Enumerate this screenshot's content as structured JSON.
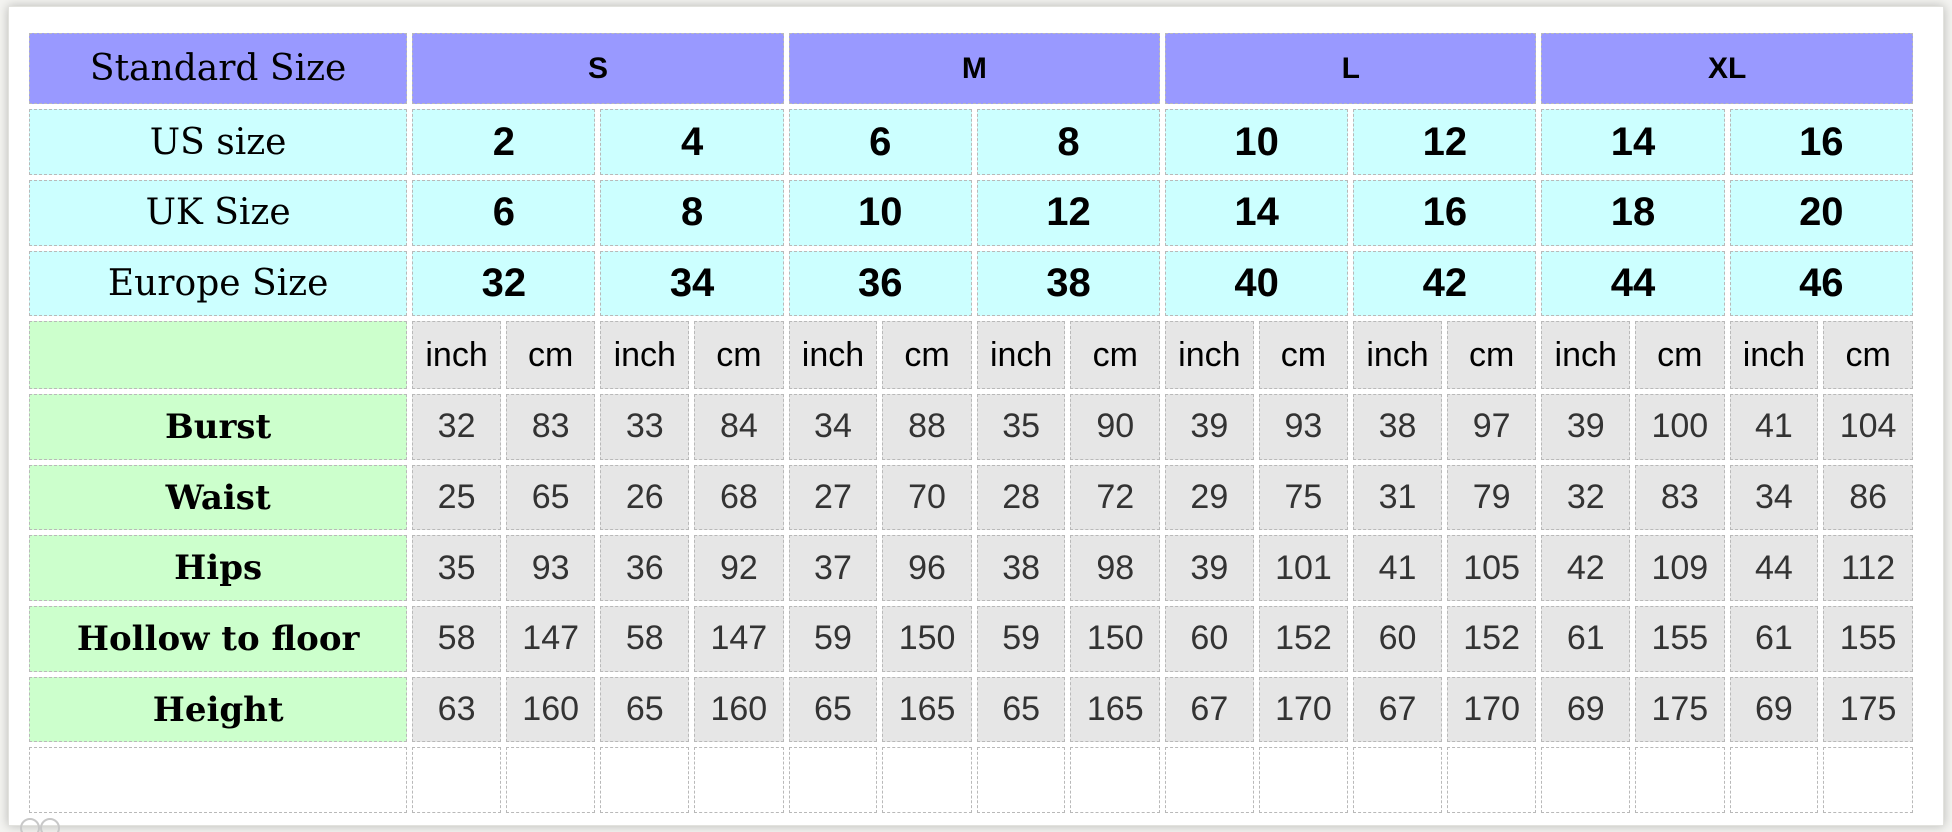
{
  "header": {
    "label": "Standard Size",
    "sizes": [
      "S",
      "M",
      "L",
      "XL"
    ]
  },
  "conversions": [
    {
      "label": "US size",
      "values": [
        "2",
        "4",
        "6",
        "8",
        "10",
        "12",
        "14",
        "16"
      ]
    },
    {
      "label": "UK Size",
      "values": [
        "6",
        "8",
        "10",
        "12",
        "14",
        "16",
        "18",
        "20"
      ]
    },
    {
      "label": "Europe Size",
      "values": [
        "32",
        "34",
        "36",
        "38",
        "40",
        "42",
        "44",
        "46"
      ]
    }
  ],
  "units": [
    "inch",
    "cm"
  ],
  "measurements": [
    {
      "label": "Burst",
      "values": [
        "32",
        "83",
        "33",
        "84",
        "34",
        "88",
        "35",
        "90",
        "39",
        "93",
        "38",
        "97",
        "39",
        "100",
        "41",
        "104"
      ]
    },
    {
      "label": "Waist",
      "values": [
        "25",
        "65",
        "26",
        "68",
        "27",
        "70",
        "28",
        "72",
        "29",
        "75",
        "31",
        "79",
        "32",
        "83",
        "34",
        "86"
      ]
    },
    {
      "label": "Hips",
      "values": [
        "35",
        "93",
        "36",
        "92",
        "37",
        "96",
        "38",
        "98",
        "39",
        "101",
        "41",
        "105",
        "42",
        "109",
        "44",
        "112"
      ]
    },
    {
      "label": "Hollow to floor",
      "values": [
        "58",
        "147",
        "58",
        "147",
        "59",
        "150",
        "59",
        "150",
        "60",
        "152",
        "60",
        "152",
        "61",
        "155",
        "61",
        "155"
      ]
    },
    {
      "label": "Height",
      "values": [
        "63",
        "160",
        "65",
        "160",
        "65",
        "165",
        "65",
        "165",
        "67",
        "170",
        "67",
        "170",
        "69",
        "175",
        "69",
        "175"
      ]
    }
  ]
}
